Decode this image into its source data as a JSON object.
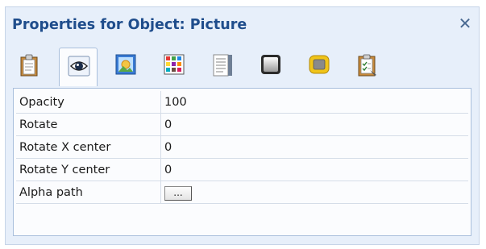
{
  "window": {
    "title": "Properties for Object: Picture",
    "close_glyph": "✕"
  },
  "toolbar": {
    "tabs": [
      {
        "icon": "clipboard-icon",
        "active": false
      },
      {
        "icon": "eye-icon",
        "active": true
      },
      {
        "icon": "picture-icon",
        "active": false
      },
      {
        "icon": "color-grid-icon",
        "active": false
      },
      {
        "icon": "text-panel-icon",
        "active": false
      },
      {
        "icon": "gradient-box-icon",
        "active": false
      },
      {
        "icon": "yellow-box-icon",
        "active": false
      },
      {
        "icon": "checklist-icon",
        "active": false
      }
    ]
  },
  "properties": {
    "rows": [
      {
        "name": "Opacity",
        "value": "100"
      },
      {
        "name": "Rotate",
        "value": "0"
      },
      {
        "name": "Rotate X center",
        "value": "0"
      },
      {
        "name": "Rotate Y center",
        "value": "0"
      },
      {
        "name": "Alpha path",
        "value": "",
        "button": "..."
      }
    ]
  },
  "colors": {
    "title": "#1f4d8c",
    "panel_bg": "#e7effa",
    "accent_yellow": "#f0c419"
  }
}
